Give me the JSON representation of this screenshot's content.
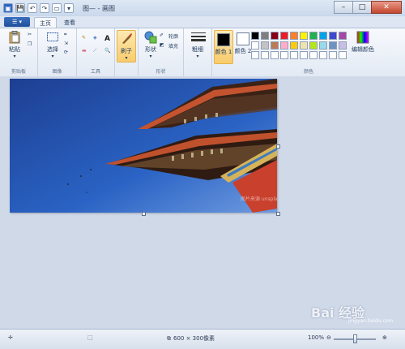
{
  "title_bar": {
    "title": "图— - 画图",
    "quick_access": [
      "save-icon",
      "undo-icon",
      "redo-icon",
      "new-icon",
      "customize-icon"
    ]
  },
  "tabs": {
    "app_menu": "▾",
    "home": "主页",
    "view": "查看"
  },
  "ribbon": {
    "clipboard": {
      "paste": "粘贴",
      "label": "剪贴板"
    },
    "image": {
      "select": "选择",
      "label": "图像"
    },
    "tools": {
      "label": "工具",
      "text_tool": "A"
    },
    "brushes": {
      "label": "刷子"
    },
    "shapes": {
      "shapes": "形状",
      "outline": "轮廓",
      "fill": "填充",
      "label": "形状"
    },
    "size": {
      "label": "粗细"
    },
    "colors": {
      "color1": "颜色 1",
      "color2": "颜色 2",
      "edit": "编辑颜色",
      "label": "颜色",
      "color1_value": "#000000",
      "color2_value": "#ffffff",
      "palette": [
        "#000000",
        "#7f7f7f",
        "#880015",
        "#ed1c24",
        "#ff7f27",
        "#fff200",
        "#22b14c",
        "#00a2e8",
        "#3f48cc",
        "#a349a4",
        "#ffffff",
        "#c3c3c3",
        "#b97a57",
        "#ffaec9",
        "#ffc90e",
        "#efe4b0",
        "#b5e61d",
        "#99d9ea",
        "#7092be",
        "#c8bfe7",
        "#ffffff",
        "#ffffff",
        "#ffffff",
        "#ffffff",
        "#ffffff",
        "#ffffff",
        "#ffffff",
        "#ffffff",
        "#ffffff",
        "#ffffff"
      ]
    }
  },
  "canvas": {
    "watermark": "图片来源 unsplash.com"
  },
  "status_bar": {
    "dimensions": "600 × 300像素",
    "zoom": "100%"
  },
  "overlay_watermark": {
    "brand": "Bai 经验",
    "sub": "jingyan.baidu.com"
  }
}
